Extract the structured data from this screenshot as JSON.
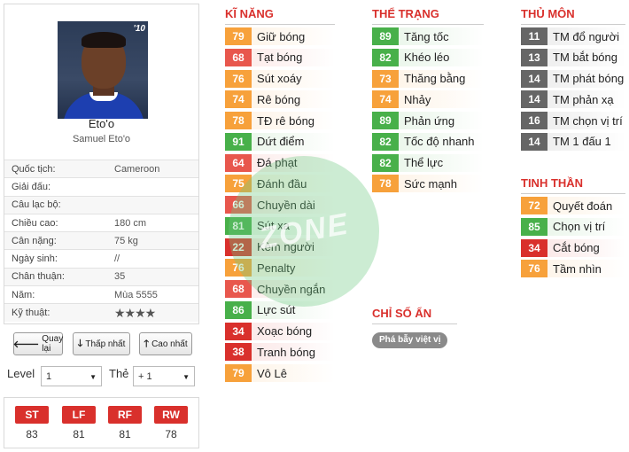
{
  "player": {
    "name": "Eto'o",
    "full_name": "Samuel Eto'o",
    "card_badge": "'10",
    "info": [
      {
        "label": "Quốc tịch:",
        "value": "Cameroon"
      },
      {
        "label": "Giải đấu:",
        "value": ""
      },
      {
        "label": "Câu lạc bộ:",
        "value": ""
      },
      {
        "label": "Chiều cao:",
        "value": "180 cm"
      },
      {
        "label": "Cân nặng:",
        "value": "75 kg"
      },
      {
        "label": "Ngày sinh:",
        "value": "//"
      },
      {
        "label": "Chân thuận:",
        "value": "35"
      },
      {
        "label": "Năm:",
        "value": "Mùa 5555"
      },
      {
        "label": "Kỹ thuật:",
        "value": "★★★★",
        "stars": 4
      }
    ]
  },
  "buttons": {
    "back": "Quay lại",
    "lower": "Thấp nhất",
    "higher": "Cao nhất"
  },
  "controls": {
    "level_label": "Level",
    "level_value": "1",
    "card_label": "Thẻ",
    "card_value": "+ 1"
  },
  "positions": [
    {
      "pos": "ST",
      "value": "83"
    },
    {
      "pos": "LF",
      "value": "81"
    },
    {
      "pos": "RF",
      "value": "81"
    },
    {
      "pos": "RW",
      "value": "78"
    }
  ],
  "sections": {
    "skills": {
      "title": "KĨ NĂNG",
      "items": [
        {
          "v": "79",
          "n": "Giữ bóng",
          "c": "#f7a13b"
        },
        {
          "v": "68",
          "n": "Tạt bóng",
          "c": "#e8574d"
        },
        {
          "v": "76",
          "n": "Sút xoáy",
          "c": "#f7a13b"
        },
        {
          "v": "74",
          "n": "Rê bóng",
          "c": "#f7a13b"
        },
        {
          "v": "78",
          "n": "TĐ rê bóng",
          "c": "#f7a13b"
        },
        {
          "v": "91",
          "n": "Dứt điểm",
          "c": "#48b04a"
        },
        {
          "v": "64",
          "n": "Đá phạt",
          "c": "#e8574d"
        },
        {
          "v": "75",
          "n": "Đánh đầu",
          "c": "#f7a13b"
        },
        {
          "v": "66",
          "n": "Chuyền dài",
          "c": "#e8574d"
        },
        {
          "v": "81",
          "n": "Sút xa",
          "c": "#48b04a"
        },
        {
          "v": "22",
          "n": "Kèm người",
          "c": "#d9302c"
        },
        {
          "v": "76",
          "n": "Penalty",
          "c": "#f7a13b"
        },
        {
          "v": "68",
          "n": "Chuyền ngắn",
          "c": "#e8574d"
        },
        {
          "v": "86",
          "n": "Lực sút",
          "c": "#48b04a"
        },
        {
          "v": "34",
          "n": "Xoạc bóng",
          "c": "#d9302c"
        },
        {
          "v": "38",
          "n": "Tranh bóng",
          "c": "#d9302c"
        },
        {
          "v": "79",
          "n": "Vô Lê",
          "c": "#f7a13b"
        }
      ]
    },
    "physical": {
      "title": "THỂ TRẠNG",
      "items": [
        {
          "v": "89",
          "n": "Tăng tốc",
          "c": "#48b04a"
        },
        {
          "v": "82",
          "n": "Khéo léo",
          "c": "#48b04a"
        },
        {
          "v": "73",
          "n": "Thăng bằng",
          "c": "#f7a13b"
        },
        {
          "v": "74",
          "n": "Nhảy",
          "c": "#f7a13b"
        },
        {
          "v": "89",
          "n": "Phản ứng",
          "c": "#48b04a"
        },
        {
          "v": "82",
          "n": "Tốc độ nhanh",
          "c": "#48b04a"
        },
        {
          "v": "82",
          "n": "Thể lực",
          "c": "#48b04a"
        },
        {
          "v": "78",
          "n": "Sức mạnh",
          "c": "#f7a13b"
        }
      ]
    },
    "goalkeeper": {
      "title": "THỦ MÔN",
      "items": [
        {
          "v": "11",
          "n": "TM đổ người",
          "c": "#666666"
        },
        {
          "v": "13",
          "n": "TM bắt bóng",
          "c": "#666666"
        },
        {
          "v": "14",
          "n": "TM phát bóng",
          "c": "#666666"
        },
        {
          "v": "14",
          "n": "TM phản xạ",
          "c": "#666666"
        },
        {
          "v": "16",
          "n": "TM chọn vị trí",
          "c": "#666666"
        },
        {
          "v": "14",
          "n": "TM 1 đấu 1",
          "c": "#666666"
        }
      ]
    },
    "mental": {
      "title": "TINH THẦN",
      "items": [
        {
          "v": "72",
          "n": "Quyết đoán",
          "c": "#f7a13b"
        },
        {
          "v": "85",
          "n": "Chọn vị trí",
          "c": "#48b04a"
        },
        {
          "v": "34",
          "n": "Cắt bóng",
          "c": "#d9302c"
        },
        {
          "v": "76",
          "n": "Tầm nhìn",
          "c": "#f7a13b"
        }
      ]
    },
    "hidden": {
      "title": "CHỈ SỐ ẨN",
      "tags": [
        "Phá bẫy việt vị"
      ]
    }
  },
  "watermark": "ZONE"
}
